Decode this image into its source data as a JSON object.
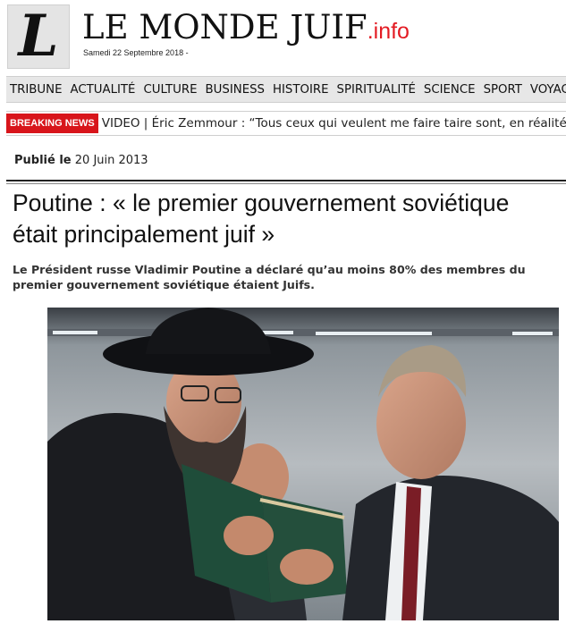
{
  "site": {
    "logo_letter": "L",
    "title": "LE MONDE JUIF",
    "tld": ".info",
    "date": "Samedi 22 Septembre 2018 -"
  },
  "nav": {
    "items": [
      "TRIBUNE",
      "ACTUALITÉ",
      "CULTURE",
      "BUSINESS",
      "HISTOIRE",
      "SPIRITUALITÉ",
      "SCIENCE",
      "SPORT",
      "VOYAGE"
    ]
  },
  "ticker": {
    "badge": "BREAKING NEWS",
    "text": "VIDEO | Éric Zemmour : “Tous ceux qui veulent me faire taire sont, en réalité,"
  },
  "article": {
    "published_label": "Publié le",
    "published_date": "20 Juin 2013",
    "headline": "Poutine : « le premier gouvernement soviétique était principalement juif »",
    "chapo": "Le Président russe Vladimir Poutine a déclaré qu’au moins 80% des membres du premier gouvernement soviétique étaient Juifs."
  },
  "colors": {
    "accent_red": "#d8151b",
    "nav_bg": "#e7e7e7"
  }
}
